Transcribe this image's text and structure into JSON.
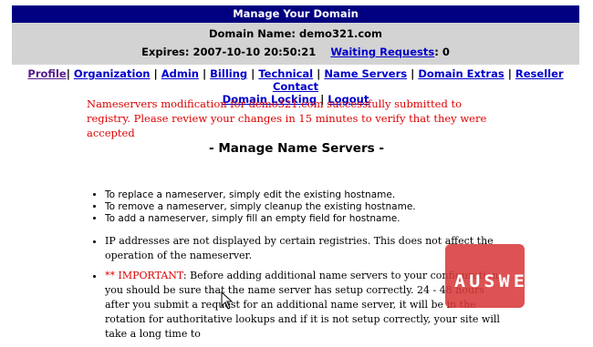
{
  "header": {
    "title": "Manage Your Domain"
  },
  "info": {
    "domain_label": "Domain Name:",
    "domain_value": "demo321.com",
    "expires_label": "Expires:",
    "expires_value": "2007-10-10 20:50:21",
    "waiting_label": "Waiting Requests",
    "waiting_count": "0"
  },
  "nav": {
    "items": [
      "Profile",
      "Organization",
      "Admin",
      "Billing",
      "Technical",
      "Name Servers",
      "Domain Extras",
      "Reseller Contact",
      "Domain Locking",
      "Logout"
    ]
  },
  "success_message": "Nameservers modification for demo321.com successfully submitted to registry. Please review your changes in 15 minutes to verify that they were accepted",
  "heading": "- Manage Name Servers -",
  "instructions": [
    "To replace a nameserver, simply edit the existing hostname.",
    "To remove a nameserver, simply cleanup the existing hostname.",
    "To add a nameserver, simply fill an empty field for hostname."
  ],
  "notes": {
    "ip_note": "IP addresses are not displayed by certain registries. This does not affect the operation of the nameserver.",
    "important_label": "** IMPORTANT",
    "important_text": ": Before adding additional name servers to your configuration, you should be sure that the name server has setup correctly. 24 - 48 hours after you submit a request for an additional name server, it will be in the rotation for authoritative lookups and if it is not setup correctly, your site will take a long time to"
  },
  "watermark": {
    "text": "AUSWEB",
    "color": "#d83a3a"
  }
}
